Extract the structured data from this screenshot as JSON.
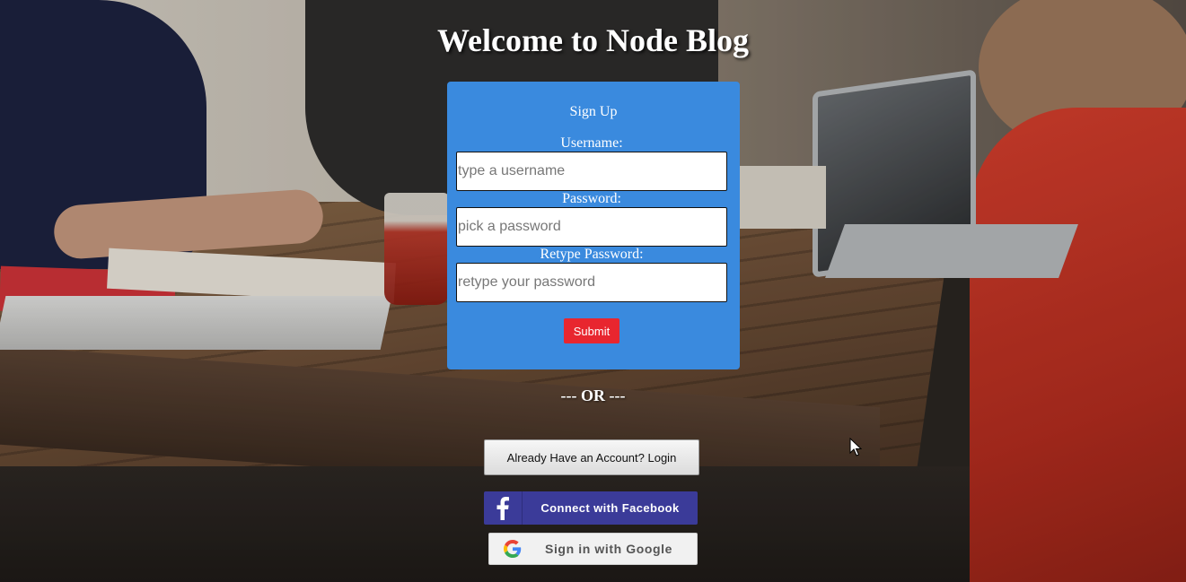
{
  "page": {
    "title": "Welcome to Node Blog"
  },
  "signup": {
    "heading": "Sign Up",
    "username_label": "Username:",
    "username_placeholder": "type a username",
    "username_value": "",
    "password_label": "Password:",
    "password_placeholder": "pick a password",
    "password_value": "",
    "retype_label": "Retype Password:",
    "retype_placeholder": "retype your password",
    "retype_value": "",
    "submit_label": "Submit"
  },
  "divider": {
    "text": "--- OR ---"
  },
  "alt_actions": {
    "login_label": "Already Have an Account? Login",
    "facebook_label": "Connect with Facebook",
    "google_label": "Sign in with Google"
  },
  "icons": {
    "facebook": "facebook-icon",
    "google": "google-icon",
    "cursor": "mouse-cursor-icon"
  },
  "colors": {
    "card_background": "#3a8ade",
    "submit_background": "#e8262f",
    "facebook_background": "#3b3b99",
    "google_background": "#f1f1f1"
  }
}
